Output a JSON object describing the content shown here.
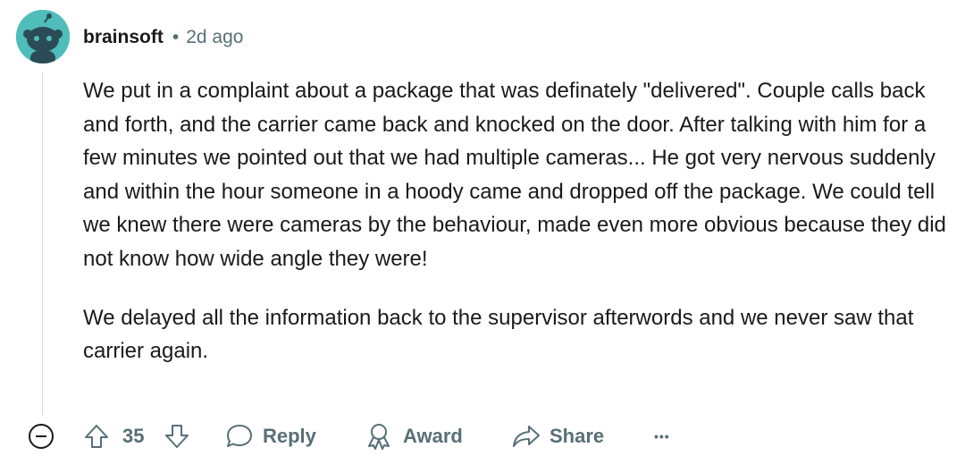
{
  "comment": {
    "author": "brainsoft",
    "separator": "•",
    "time": "2d ago",
    "paragraphs": [
      "We put in a complaint about a package that was definately \"delivered\". Couple calls back and forth, and the carrier came back and knocked on the door. After talking with him for a few minutes we pointed out that we had multiple cameras... He got very nervous suddenly and within the hour someone in a hoody came and dropped off the package. We could tell we knew there were cameras by the behaviour, made even more obvious because they did not know how wide angle they were!",
      "We delayed all the information back to the supervisor afterwords and we never saw that carrier again."
    ]
  },
  "actions": {
    "score": "35",
    "reply_label": "Reply",
    "award_label": "Award",
    "share_label": "Share",
    "more_label": "•••"
  },
  "colors": {
    "avatar_bg": "#4fbdba",
    "meta_gray": "#576f76",
    "text": "#1a1a1b"
  },
  "icons": [
    "avatar-icon",
    "collapse-icon",
    "upvote-icon",
    "downvote-icon",
    "reply-icon",
    "award-icon",
    "share-icon",
    "more-icon"
  ]
}
